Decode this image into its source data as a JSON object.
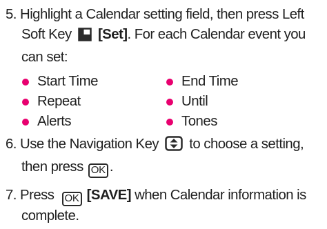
{
  "steps": [
    {
      "number": "5.",
      "line1_text": "Highlight a Calendar setting field, then press Left",
      "line2_pre": "Soft Key",
      "line2_bold": "[Set]",
      "line2_post": ". For each Calendar event you",
      "line3": "can set:"
    },
    {
      "number": "6.",
      "line1_pre": "Use the Navigation Key",
      "line1_post": "to choose a setting,",
      "line2_pre": "then press",
      "line2_post": "."
    },
    {
      "number": "7.",
      "line1_pre": "Press",
      "line1_bold": "[SAVE]",
      "line1_post": "when Calendar information is",
      "line2": "complete."
    }
  ],
  "options": [
    [
      "Start Time",
      "End Time"
    ],
    [
      "Repeat",
      "Until"
    ],
    [
      "Alerts",
      "Tones"
    ]
  ],
  "keys": {
    "ok_label": "OK"
  },
  "icons": {
    "left_soft_key": "left-soft-key-icon",
    "navigation_key": "navigation-key-icon",
    "ok_key": "ok-key-icon"
  },
  "colors": {
    "bullet": "#e8006f",
    "text": "#1f1f1f"
  }
}
